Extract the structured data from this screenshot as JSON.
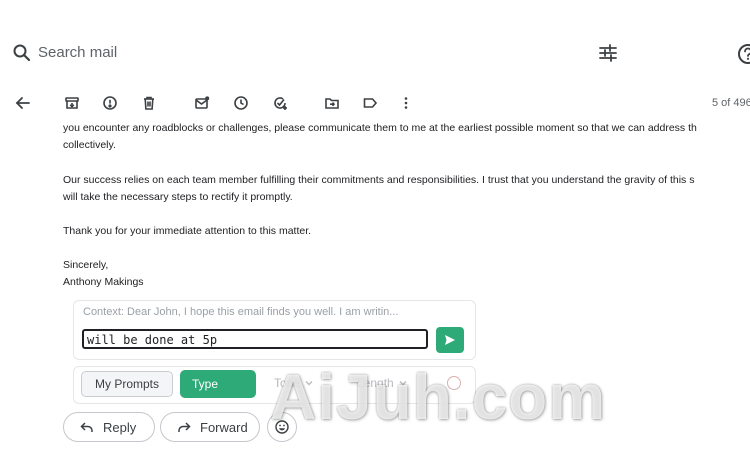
{
  "search": {
    "placeholder": "Search mail"
  },
  "toolbar": {
    "counter": "5 of 496"
  },
  "message": {
    "paragraphs": [
      "you encounter any roadblocks or challenges, please communicate them to me at the earliest possible moment so that we can address th",
      "collectively.",
      "Our success relies on each team member fulfilling their commitments and responsibilities. I trust that you understand the gravity of this s",
      "will take the necessary steps to rectify it promptly.",
      "Thank you for your immediate attention to this matter.",
      "Sincerely,",
      "Anthony Makings"
    ]
  },
  "ai_panel": {
    "context": "Context: Dear John, I hope this email finds you well. I am writin...",
    "input_value": "will be done at 5p",
    "my_prompts_label": "My Prompts",
    "type_label": "Type",
    "tone_label": "Tone",
    "length_label": "Length"
  },
  "actions": {
    "reply_label": "Reply",
    "forward_label": "Forward"
  },
  "watermark": "AiJuh.com",
  "colors": {
    "accent": "#2eaa78",
    "text": "#202124",
    "muted": "#5f6368"
  },
  "icons": [
    "search-icon",
    "filter-icon",
    "help-icon",
    "back-arrow-icon",
    "archive-icon",
    "report-spam-icon",
    "delete-icon",
    "mark-unread-icon",
    "snooze-icon",
    "add-task-icon",
    "move-to-icon",
    "label-icon",
    "more-vert-icon",
    "send-icon",
    "reply-icon",
    "forward-icon",
    "emoji-icon"
  ]
}
